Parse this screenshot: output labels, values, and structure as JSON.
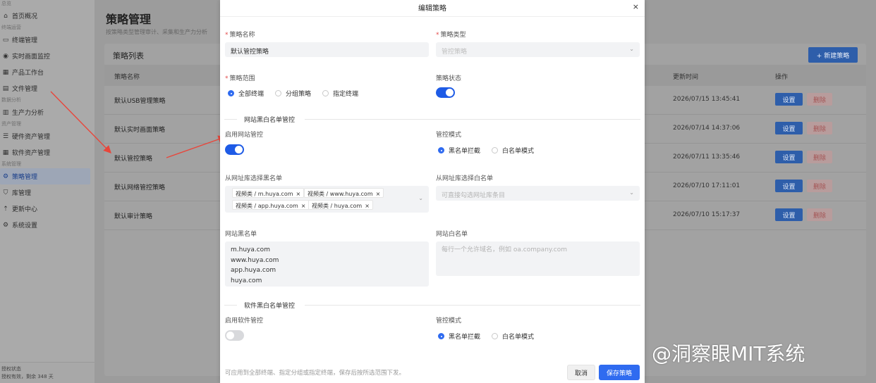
{
  "sidebar": {
    "groups": {
      "g1": "总览",
      "g2": "终端运营",
      "g3": "数据分析",
      "g4": "资产管理",
      "g5": "系统管理"
    },
    "items": [
      {
        "label": "首页概况",
        "icon": "home-icon"
      },
      {
        "label": "终端管理",
        "icon": "monitor-icon"
      },
      {
        "label": "实时画面监控",
        "icon": "eye-icon"
      },
      {
        "label": "产品工作台",
        "icon": "grid-icon"
      },
      {
        "label": "文件管理",
        "icon": "file-icon"
      },
      {
        "label": "生产力分析",
        "icon": "bar-chart-icon"
      },
      {
        "label": "硬件资产管理",
        "icon": "list-icon"
      },
      {
        "label": "软件资产管理",
        "icon": "apps-icon"
      },
      {
        "label": "策略管理",
        "icon": "gear-icon"
      },
      {
        "label": "库管理",
        "icon": "shield-icon"
      },
      {
        "label": "更新中心",
        "icon": "upload-icon"
      },
      {
        "label": "系统设置",
        "icon": "settings-icon"
      }
    ],
    "footer": {
      "line1": "授权状态",
      "line2": "授权有效，剩余 348 天"
    }
  },
  "main": {
    "title": "策略管理",
    "subtitle": "按策略类型管理审计、采集和生产力分析",
    "panel_title": "策略列表",
    "new_button": "+ 新建策略",
    "columns": {
      "name": "策略名称",
      "time": "更新时间",
      "ops": "操作"
    },
    "rows": [
      {
        "name": "默认USB管理策略",
        "time": "2026/07/15 13:45:41"
      },
      {
        "name": "默认实时画面策略",
        "time": "2026/07/14 14:37:06"
      },
      {
        "name": "默认管控策略",
        "time": "2026/07/11 13:35:46"
      },
      {
        "name": "默认网络管控策略",
        "time": "2026/07/10 17:11:01"
      },
      {
        "name": "默认审计策略",
        "time": "2026/07/10 15:17:37"
      }
    ],
    "set_label": "设置",
    "del_label": "删除"
  },
  "modal": {
    "title": "编辑策略",
    "close": "×",
    "name_label": "策略名称",
    "name_value": "默认管控策略",
    "type_label": "策略类型",
    "type_value": "管控策略",
    "scope_label": "策略范围",
    "scope_options": [
      "全部终端",
      "分组策略",
      "指定终端"
    ],
    "status_label": "策略状态",
    "web_section": "网站黑白名单管控",
    "web_enable_label": "启用网站管控",
    "web_mode_label": "管控模式",
    "mode_black": "黑名单拦截",
    "mode_white": "白名单模式",
    "black_lib_label": "从网址库选择黑名单",
    "white_lib_label": "从网址库选择白名单",
    "white_lib_placeholder": "可直接勾选网址库条目",
    "tags": [
      "视频类 / m.huya.com",
      "视频类 / www.huya.com",
      "视频类 / app.huya.com",
      "视频类 / huya.com"
    ],
    "tag_remove": "×",
    "blacklist_label": "网站黑名单",
    "blacklist_lines": [
      "m.huya.com",
      "www.huya.com",
      "app.huya.com",
      "huya.com"
    ],
    "whitelist_label": "网站白名单",
    "whitelist_placeholder": "每行一个允许域名，例如 oa.company.com",
    "soft_section": "软件黑白名单管控",
    "soft_enable_label": "启用软件管控",
    "soft_mode_label": "管控模式",
    "footer_note": "可应用到全部终端、指定分组或指定终端，保存后按所选范围下发。",
    "cancel": "取消",
    "save": "保存策略"
  },
  "watermark": "@洞察眼MIT系统",
  "colors": {
    "primary": "#2f6bf0",
    "danger": "#e34b4b",
    "annotation_arrow": "#e8463b"
  }
}
